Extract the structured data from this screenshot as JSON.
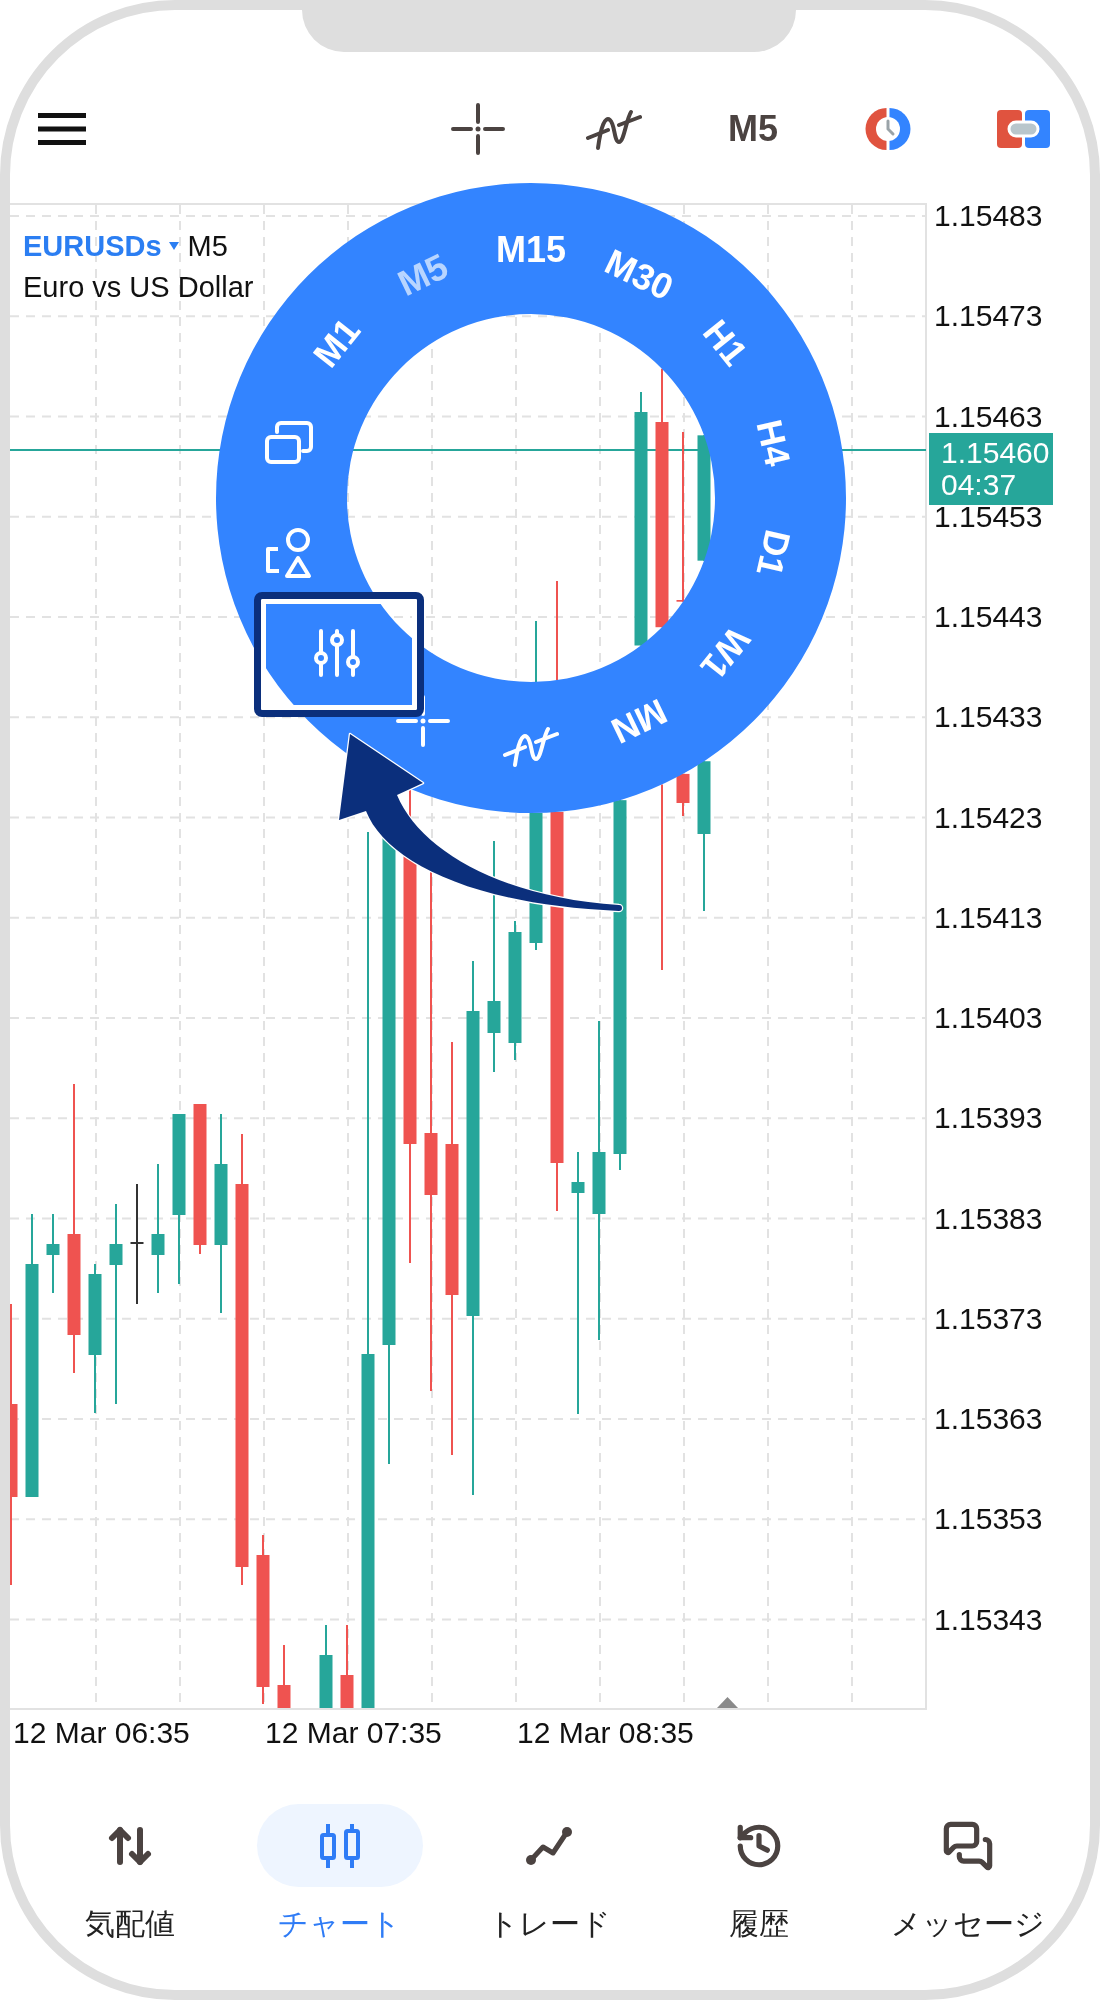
{
  "top_bar": {
    "timeframe": "M5"
  },
  "chart": {
    "symbol": "EURUSDs",
    "timeframe": "M5",
    "description": "Euro vs US Dollar",
    "price_axis": [
      "1.15483",
      "1.15473",
      "1.15463",
      "1.15453",
      "1.15443",
      "1.15433",
      "1.15423",
      "1.15413",
      "1.15403",
      "1.15393",
      "1.15383",
      "1.15373",
      "1.15363",
      "1.15353",
      "1.15343"
    ],
    "current_price": "1.15460",
    "countdown": "04:37",
    "time_axis": [
      "12 Mar 06:35",
      "12 Mar 07:35",
      "12 Mar 08:35"
    ]
  },
  "radial_menu": {
    "timeframes": [
      {
        "label": "M1",
        "selected": false
      },
      {
        "label": "M5",
        "selected": true
      },
      {
        "label": "M15",
        "selected": false
      },
      {
        "label": "M30",
        "selected": false
      },
      {
        "label": "H1",
        "selected": false
      },
      {
        "label": "H4",
        "selected": false
      },
      {
        "label": "D1",
        "selected": false
      },
      {
        "label": "W1",
        "selected": false
      },
      {
        "label": "MN",
        "selected": false
      }
    ],
    "tools": [
      {
        "kind": "indicators",
        "highlighted": false
      },
      {
        "kind": "crosshair",
        "highlighted": false
      },
      {
        "kind": "settings",
        "highlighted": true
      },
      {
        "kind": "objects",
        "highlighted": false
      },
      {
        "kind": "windows",
        "highlighted": false
      }
    ]
  },
  "bottom_nav": [
    {
      "kind": "quotes",
      "label": "気配値",
      "selected": false
    },
    {
      "kind": "chart",
      "label": "チャート",
      "selected": true
    },
    {
      "kind": "trade",
      "label": "トレード",
      "selected": false
    },
    {
      "kind": "history",
      "label": "履歴",
      "selected": false
    },
    {
      "kind": "messages",
      "label": "メッセージ",
      "selected": false
    }
  ]
}
